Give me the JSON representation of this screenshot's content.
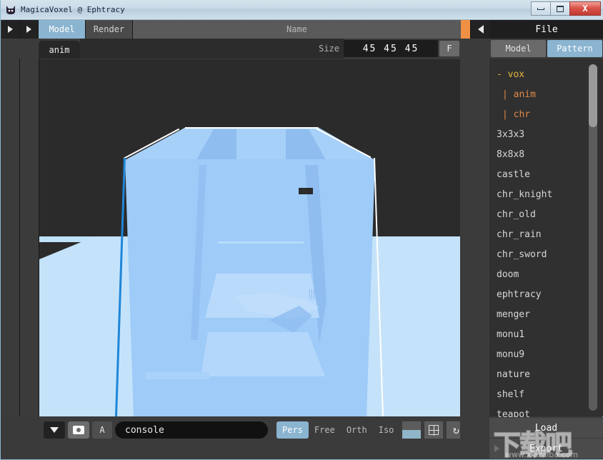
{
  "window": {
    "title": "MagicaVoxel @ Ephtracy",
    "icon": "app-cat-icon",
    "controls": {
      "minimize": "–",
      "maximize": "□",
      "close": "X"
    }
  },
  "topbar": {
    "prev_arrow": "▶",
    "next_arrow": "▶",
    "tabs": [
      {
        "label": "Model",
        "active": true
      },
      {
        "label": "Render",
        "active": false
      }
    ],
    "name_placeholder": "Name",
    "collapse_arrow": "◀",
    "panel_title": "File"
  },
  "secondrow": {
    "anim_tab": "anim",
    "size_label": "Size",
    "size_value": "45 45 45",
    "fit_button": "F",
    "panel_tabs": [
      {
        "label": "Model",
        "active": false
      },
      {
        "label": "Pattern",
        "active": true
      }
    ]
  },
  "filepanel": {
    "items": [
      {
        "label": "- vox",
        "type": "root"
      },
      {
        "label": "| anim",
        "type": "child"
      },
      {
        "label": "| chr",
        "type": "child"
      },
      {
        "label": "3x3x3",
        "type": "file"
      },
      {
        "label": "8x8x8",
        "type": "file"
      },
      {
        "label": "castle",
        "type": "file"
      },
      {
        "label": "chr_knight",
        "type": "file"
      },
      {
        "label": "chr_old",
        "type": "file"
      },
      {
        "label": "chr_rain",
        "type": "file"
      },
      {
        "label": "chr_sword",
        "type": "file"
      },
      {
        "label": "doom",
        "type": "file"
      },
      {
        "label": "ephtracy",
        "type": "file"
      },
      {
        "label": "menger",
        "type": "file"
      },
      {
        "label": "monu1",
        "type": "file"
      },
      {
        "label": "monu9",
        "type": "file"
      },
      {
        "label": "nature",
        "type": "file"
      },
      {
        "label": "shelf",
        "type": "file"
      },
      {
        "label": "teapot",
        "type": "file"
      }
    ],
    "load_button": "Load",
    "export_button": "Export"
  },
  "bottombar": {
    "menu_arrow": "▼",
    "camera_icon": "camera-icon",
    "text_button": "A",
    "console_value": "console",
    "projections": [
      {
        "label": "Pers",
        "active": true
      },
      {
        "label": "Free",
        "active": false
      },
      {
        "label": "Orth",
        "active": false
      },
      {
        "label": "Iso",
        "active": false
      }
    ],
    "shade_button": "shade-icon",
    "grid_button": "grid-icon",
    "rotate_button": "↻",
    "color_swatch": "#e3bb3a"
  },
  "watermark": {
    "cjk": "下载吧",
    "url": "www.xiazaiba.com"
  },
  "colors": {
    "accent_blue": "#8ab4d0",
    "orange_bar": "#f09045",
    "root_yellow": "#e8b83c",
    "child_orange": "#e08a4a",
    "swatch_yellow": "#e3bb3a"
  }
}
